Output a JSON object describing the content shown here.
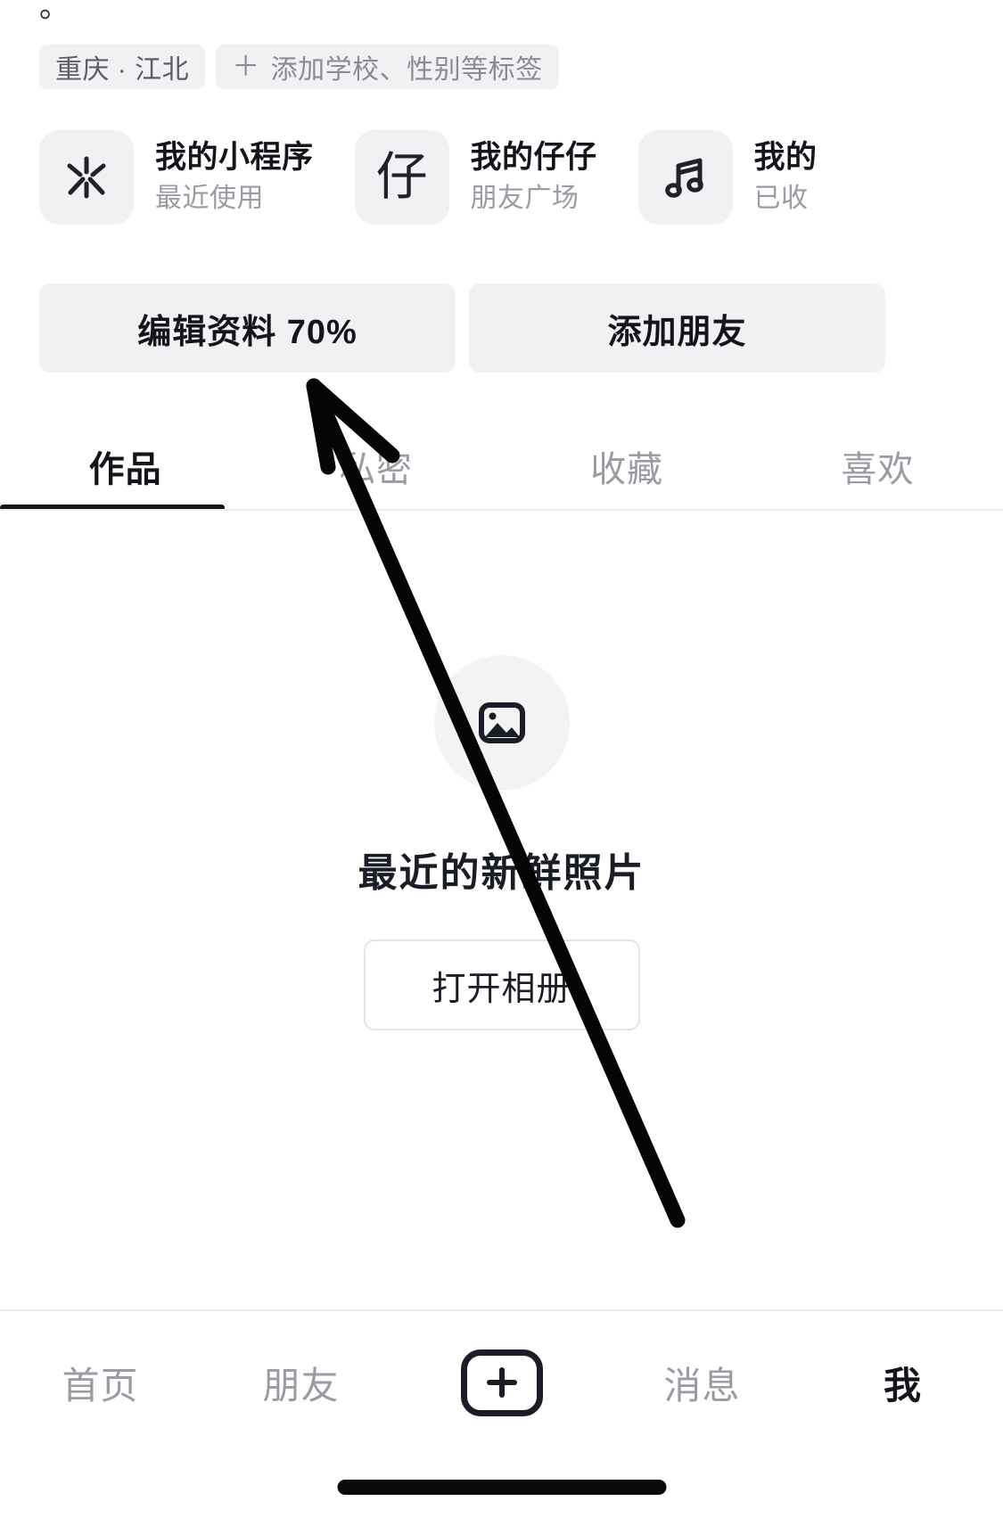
{
  "top_cut_text": "。",
  "tags": [
    {
      "label": "重庆 · 江北",
      "type": "location"
    },
    {
      "label": "添加学校、性别等标签",
      "type": "add",
      "plus": "＋"
    }
  ],
  "mini_programs": [
    {
      "icon": "sparkle-icon",
      "title": "我的小程序",
      "subtitle": "最近使用"
    },
    {
      "icon": "zai-glyph-icon",
      "glyph": "仔",
      "title": "我的仔仔",
      "subtitle": "朋友广场"
    },
    {
      "icon": "music-note-icon",
      "title": "我的",
      "subtitle": "已收"
    }
  ],
  "actions": [
    {
      "label": "编辑资料 70%",
      "name": "edit-profile-button"
    },
    {
      "label": "添加朋友",
      "name": "add-friend-button"
    }
  ],
  "tabs": [
    {
      "label": "作品",
      "active": true
    },
    {
      "label": "私密",
      "active": false
    },
    {
      "label": "收藏",
      "active": false
    },
    {
      "label": "喜欢",
      "active": false
    }
  ],
  "empty_state": {
    "icon": "image-placeholder-icon",
    "title": "最近的新鲜照片",
    "button_label": "打开相册"
  },
  "bottom_nav": [
    {
      "label": "首页",
      "active": false
    },
    {
      "label": "朋友",
      "active": false
    },
    {
      "label": "＋",
      "active": false,
      "type": "create"
    },
    {
      "label": "消息",
      "active": false
    },
    {
      "label": "我",
      "active": true
    }
  ],
  "colors": {
    "text_primary": "#14151a",
    "text_muted": "#9a9ba3",
    "chip_bg": "#f1f1f3",
    "accent": "#1b1d26"
  }
}
